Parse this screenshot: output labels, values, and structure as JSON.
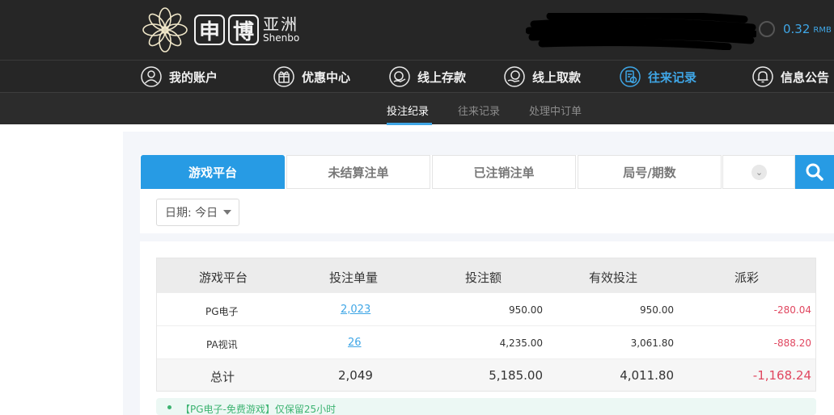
{
  "header": {
    "logo_char1": "申",
    "logo_char2": "博",
    "logo_cn": "亚洲",
    "logo_en": "Shenbo",
    "balance_value": "0.32",
    "balance_currency": "RMB"
  },
  "nav": [
    {
      "label": "我的账户",
      "icon": "user-icon"
    },
    {
      "label": "优惠中心",
      "icon": "gift-icon"
    },
    {
      "label": "线上存款",
      "icon": "deposit-icon"
    },
    {
      "label": "线上取款",
      "icon": "withdraw-icon"
    },
    {
      "label": "往来记录",
      "icon": "records-icon",
      "active": true
    },
    {
      "label": "信息公告",
      "icon": "bell-icon"
    }
  ],
  "subnav": [
    {
      "label": "投注纪录",
      "active": true
    },
    {
      "label": "往来记录"
    },
    {
      "label": "处理中订单"
    }
  ],
  "filter_tabs": [
    {
      "label": "游戏平台",
      "active": true
    },
    {
      "label": "未结算注单"
    },
    {
      "label": "已注销注单"
    },
    {
      "label": "局号/期数"
    }
  ],
  "date_filter": "日期: 今日",
  "table": {
    "headers": [
      "游戏平台",
      "投注单量",
      "投注额",
      "有效投注",
      "派彩"
    ],
    "rows": [
      {
        "platform": "PG电子",
        "count": "2,023",
        "amount": "950.00",
        "valid": "950.00",
        "payout": "-280.04"
      },
      {
        "platform": "PA视讯",
        "count": "26",
        "amount": "4,235.00",
        "valid": "3,061.80",
        "payout": "-888.20"
      }
    ],
    "total": {
      "label": "总计",
      "count": "2,049",
      "amount": "5,185.00",
      "valid": "4,011.80",
      "payout": "-1,168.24"
    }
  },
  "notice": "【PG电子-免费游戏】仅保留25小时",
  "colors": {
    "accent": "#279be4",
    "link": "#3fa6e6",
    "negative": "#e0465f",
    "header_bg": "#262626"
  }
}
